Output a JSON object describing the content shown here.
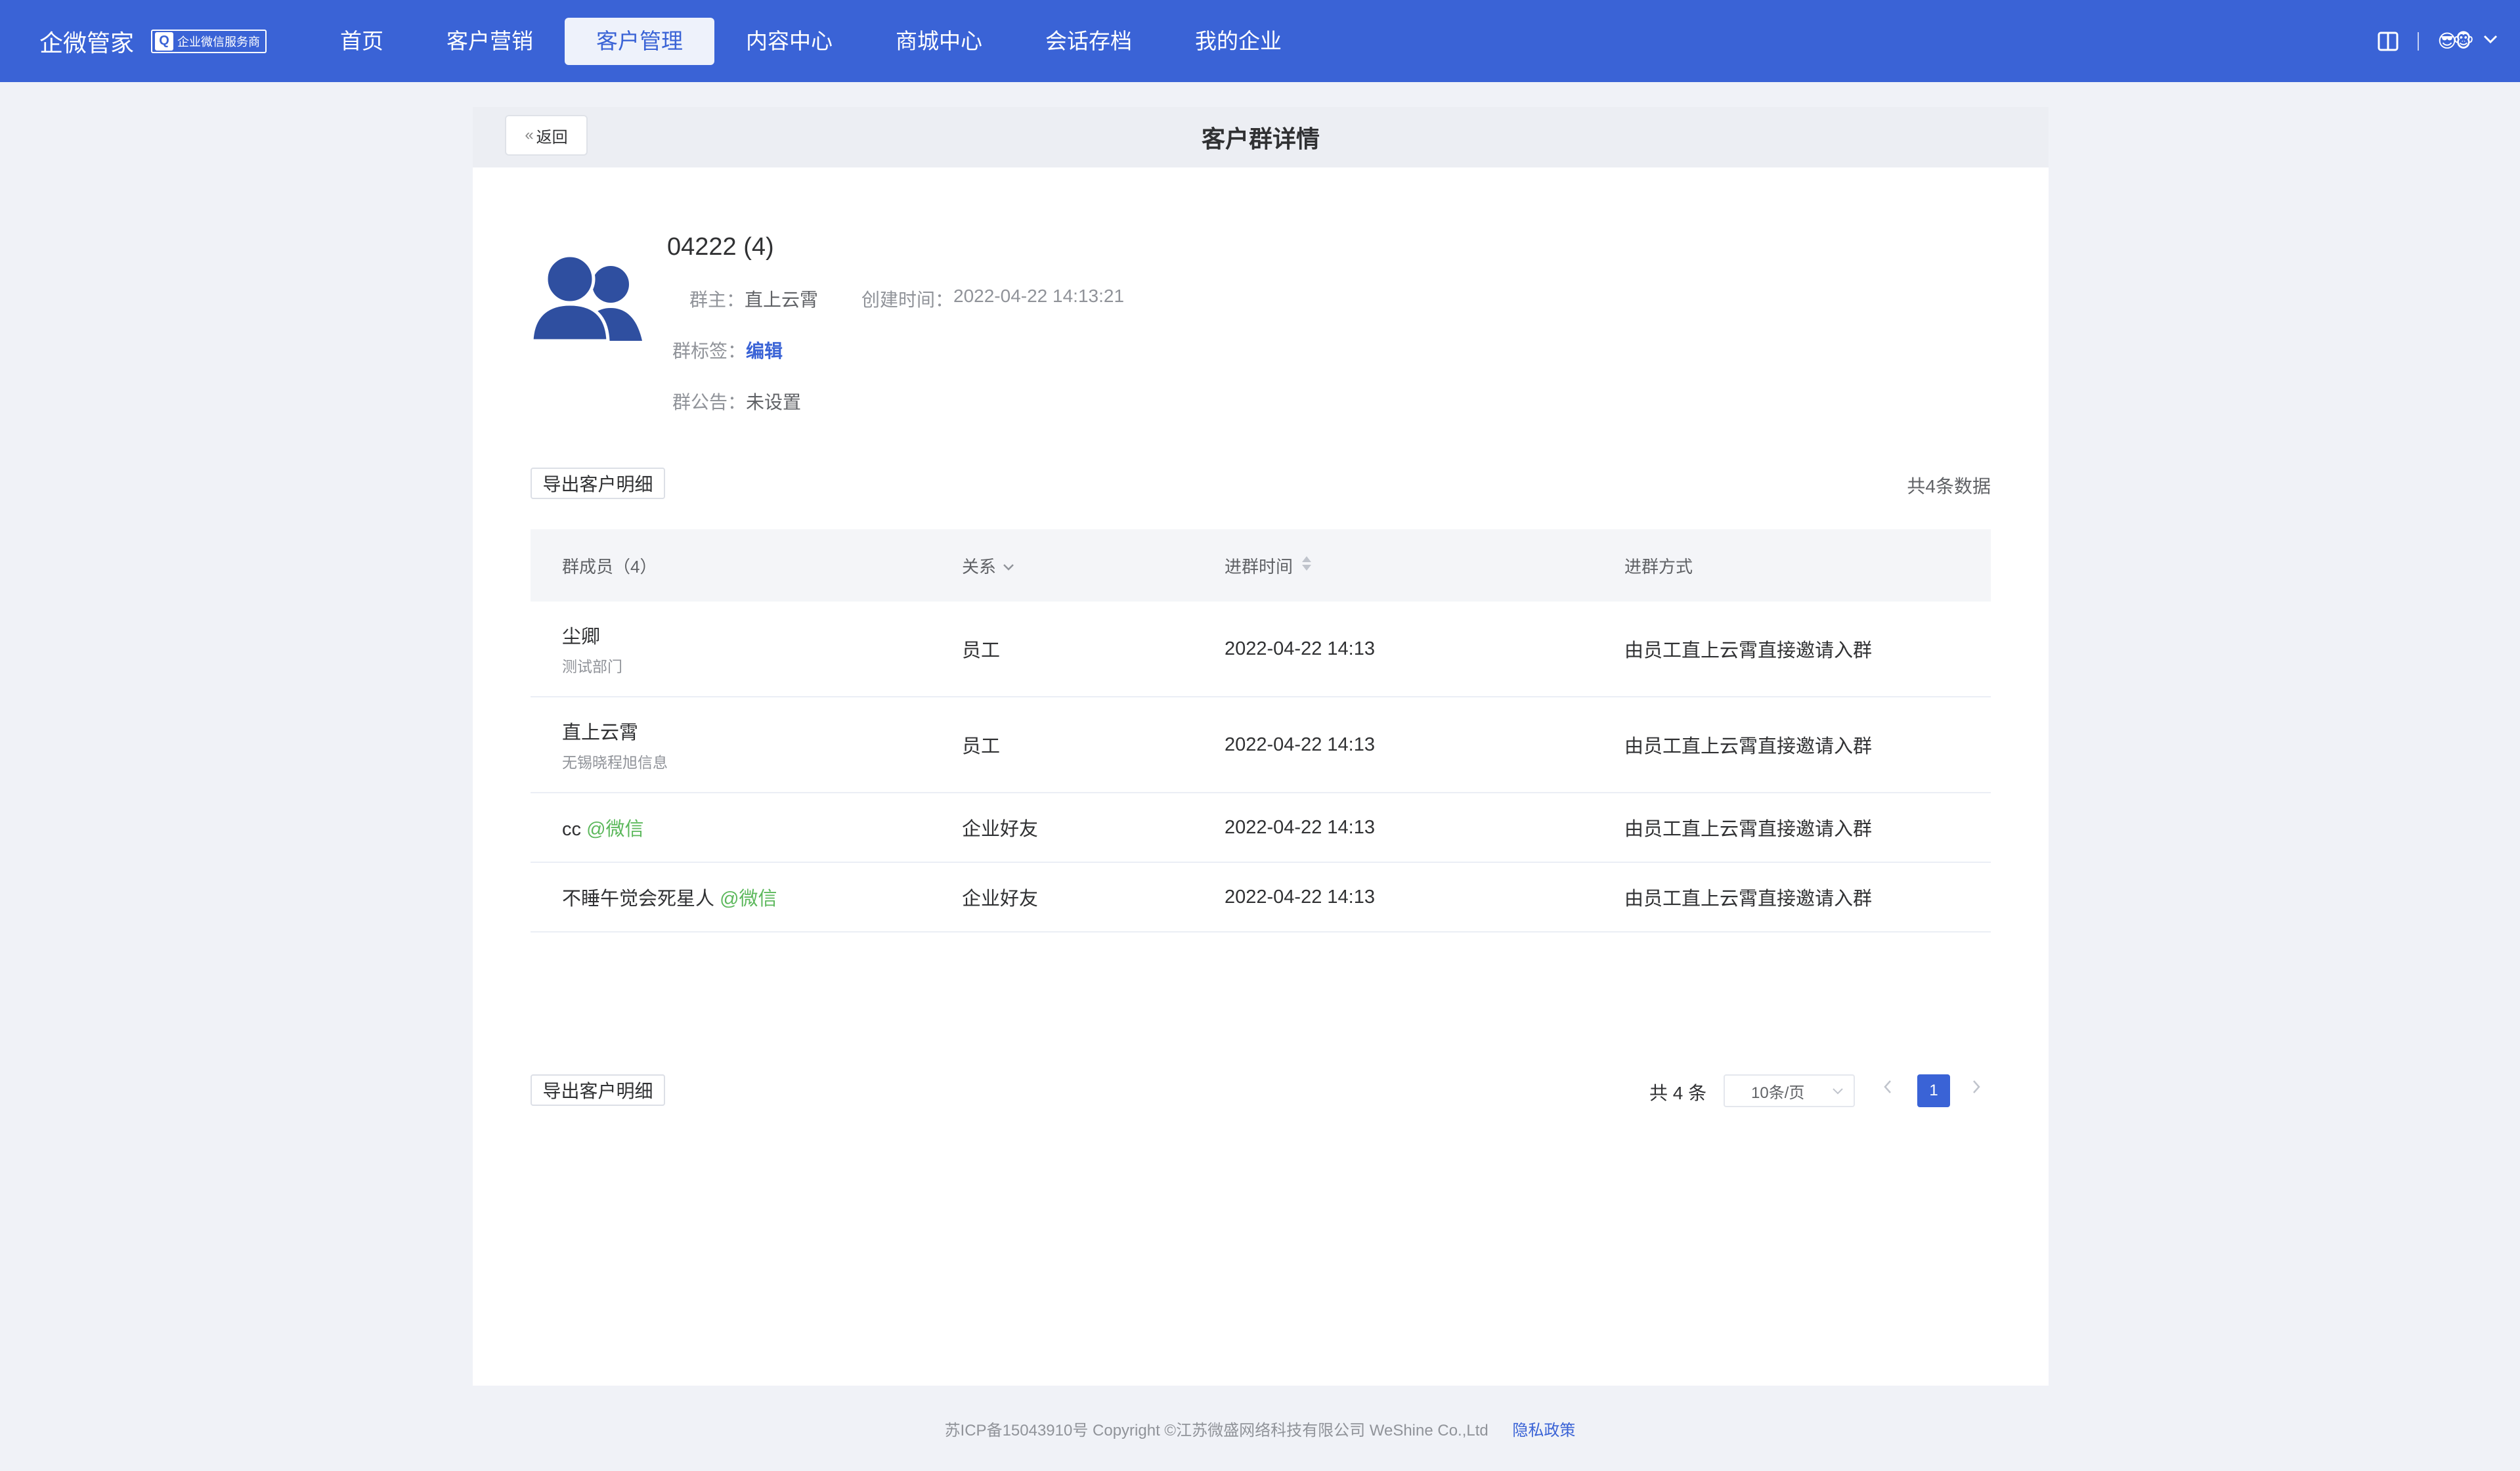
{
  "nav": {
    "brand": "企微管家",
    "badge": "企业微信服务商",
    "items": [
      {
        "label": "首页",
        "active": false
      },
      {
        "label": "客户营销",
        "active": false
      },
      {
        "label": "客户管理",
        "active": true
      },
      {
        "label": "内容中心",
        "active": false
      },
      {
        "label": "商城中心",
        "active": false
      },
      {
        "label": "会话存档",
        "active": false
      },
      {
        "label": "我的企业",
        "active": false
      }
    ],
    "avatar": "😎🐵"
  },
  "page": {
    "back": "返回",
    "title": "客户群详情"
  },
  "group": {
    "name": "04222 (4)",
    "owner_label": "群主：",
    "owner": "直上云霄",
    "created_label": "创建时间：",
    "created": "2022-04-22 14:13:21",
    "tags_label": "群标签：",
    "tags_edit": "编辑",
    "notice_label": "群公告：",
    "notice": "未设置"
  },
  "actions": {
    "export": "导出客户明细",
    "total_top": "共4条数据"
  },
  "table": {
    "headers": {
      "member": "群成员（4）",
      "relation": "关系",
      "join_time": "进群时间",
      "join_method": "进群方式"
    },
    "rows": [
      {
        "name": "尘卿",
        "tag": "",
        "sub": "测试部门",
        "relation": "员工",
        "time": "2022-04-22 14:13",
        "method": "由员工直上云霄直接邀请入群"
      },
      {
        "name": "直上云霄",
        "tag": "",
        "sub": "无锡晓程旭信息",
        "relation": "员工",
        "time": "2022-04-22 14:13",
        "method": "由员工直上云霄直接邀请入群"
      },
      {
        "name": "cc",
        "tag": "@微信",
        "sub": "",
        "relation": "企业好友",
        "time": "2022-04-22 14:13",
        "method": "由员工直上云霄直接邀请入群"
      },
      {
        "name": "不睡午觉会死星人",
        "tag": "@微信",
        "sub": "",
        "relation": "企业好友",
        "time": "2022-04-22 14:13",
        "method": "由员工直上云霄直接邀请入群"
      }
    ]
  },
  "pagination": {
    "total": "共 4 条",
    "page_size": "10条/页",
    "current": "1"
  },
  "footer": {
    "copyright": "苏ICP备15043910号 Copyright ©江苏微盛网络科技有限公司 WeShine Co.,Ltd",
    "privacy": "隐私政策"
  }
}
